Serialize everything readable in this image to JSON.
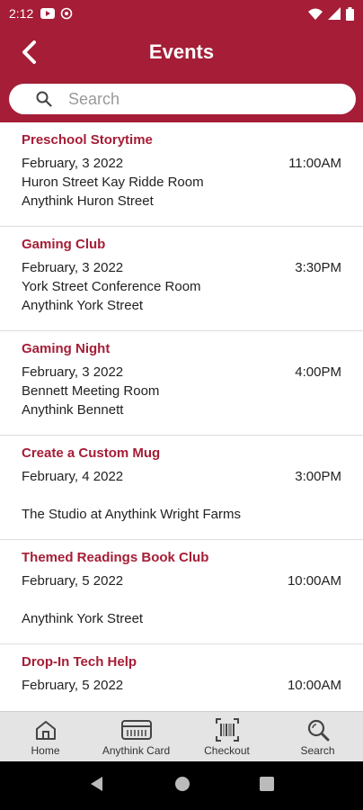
{
  "status_bar": {
    "time": "2:12",
    "icons": [
      "youtube-icon",
      "hotspot-icon",
      "wifi-icon",
      "signal-icon",
      "battery-icon"
    ]
  },
  "header": {
    "title": "Events",
    "back_icon": "chevron-left-icon"
  },
  "search": {
    "placeholder": "Search",
    "value": ""
  },
  "colors": {
    "brand": "#a51d36",
    "nav_bg": "#e4e4e4",
    "text": "#222222"
  },
  "events": [
    {
      "title": "Preschool Storytime",
      "date": "February, 3 2022",
      "time": "11:00AM",
      "room": "Huron Street Kay Ridde Room",
      "location": "Anythink Huron Street"
    },
    {
      "title": "Gaming Club",
      "date": "February, 3 2022",
      "time": "3:30PM",
      "room": "York Street Conference Room",
      "location": "Anythink York Street"
    },
    {
      "title": "Gaming Night",
      "date": "February, 3 2022",
      "time": "4:00PM",
      "room": "Bennett Meeting Room",
      "location": "Anythink Bennett"
    },
    {
      "title": "Create a Custom Mug",
      "date": "February, 4 2022",
      "time": "3:00PM",
      "room": "",
      "location": "The Studio at Anythink Wright Farms"
    },
    {
      "title": "Themed Readings Book Club",
      "date": "February, 5 2022",
      "time": "10:00AM",
      "room": "",
      "location": "Anythink York Street"
    },
    {
      "title": "Drop-In Tech Help",
      "date": "February, 5 2022",
      "time": "10:00AM",
      "room": "",
      "location": ""
    }
  ],
  "bottom_nav": [
    {
      "label": "Home",
      "icon": "home-icon"
    },
    {
      "label": "Anythink Card",
      "icon": "card-icon"
    },
    {
      "label": "Checkout",
      "icon": "barcode-icon"
    },
    {
      "label": "Search",
      "icon": "search-icon"
    }
  ]
}
